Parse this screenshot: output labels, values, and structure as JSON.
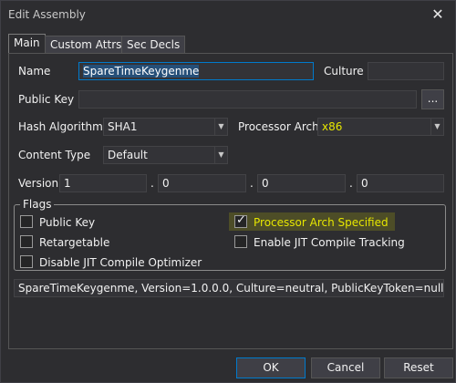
{
  "window": {
    "title": "Edit Assembly",
    "close_icon": "close-icon"
  },
  "tabs": [
    {
      "label": "Main",
      "active": true
    },
    {
      "label": "Custom Attrs",
      "active": false
    },
    {
      "label": "Sec Decls",
      "active": false
    }
  ],
  "fields": {
    "name_label": "Name",
    "name_value": "SpareTimeKeygenme",
    "culture_label": "Culture",
    "culture_value": "",
    "public_key_label": "Public Key",
    "public_key_value": "",
    "public_key_browse": "...",
    "hash_label": "Hash Algorithm",
    "hash_value": "SHA1",
    "proc_arch_label": "Processor Arch",
    "proc_arch_value": "x86",
    "content_type_label": "Content Type",
    "content_type_value": "Default",
    "version_label": "Version",
    "version": [
      "1",
      "0",
      "0",
      "0"
    ],
    "version_sep": "."
  },
  "flags": {
    "legend": "Flags",
    "items": [
      {
        "label": "Public Key",
        "checked": false
      },
      {
        "label": "Retargetable",
        "checked": false
      },
      {
        "label": "Disable JIT Compile Optimizer",
        "checked": false
      },
      {
        "label": "Processor Arch Specified",
        "checked": true
      },
      {
        "label": "Enable JIT Compile Tracking",
        "checked": false
      }
    ],
    "check_glyph": "✓"
  },
  "fullname": "SpareTimeKeygenme, Version=1.0.0.0, Culture=neutral, PublicKeyToken=null",
  "buttons": {
    "ok": "OK",
    "cancel": "Cancel",
    "reset": "Reset"
  },
  "colors": {
    "highlight": "#e6e600",
    "accent": "#007acc"
  }
}
